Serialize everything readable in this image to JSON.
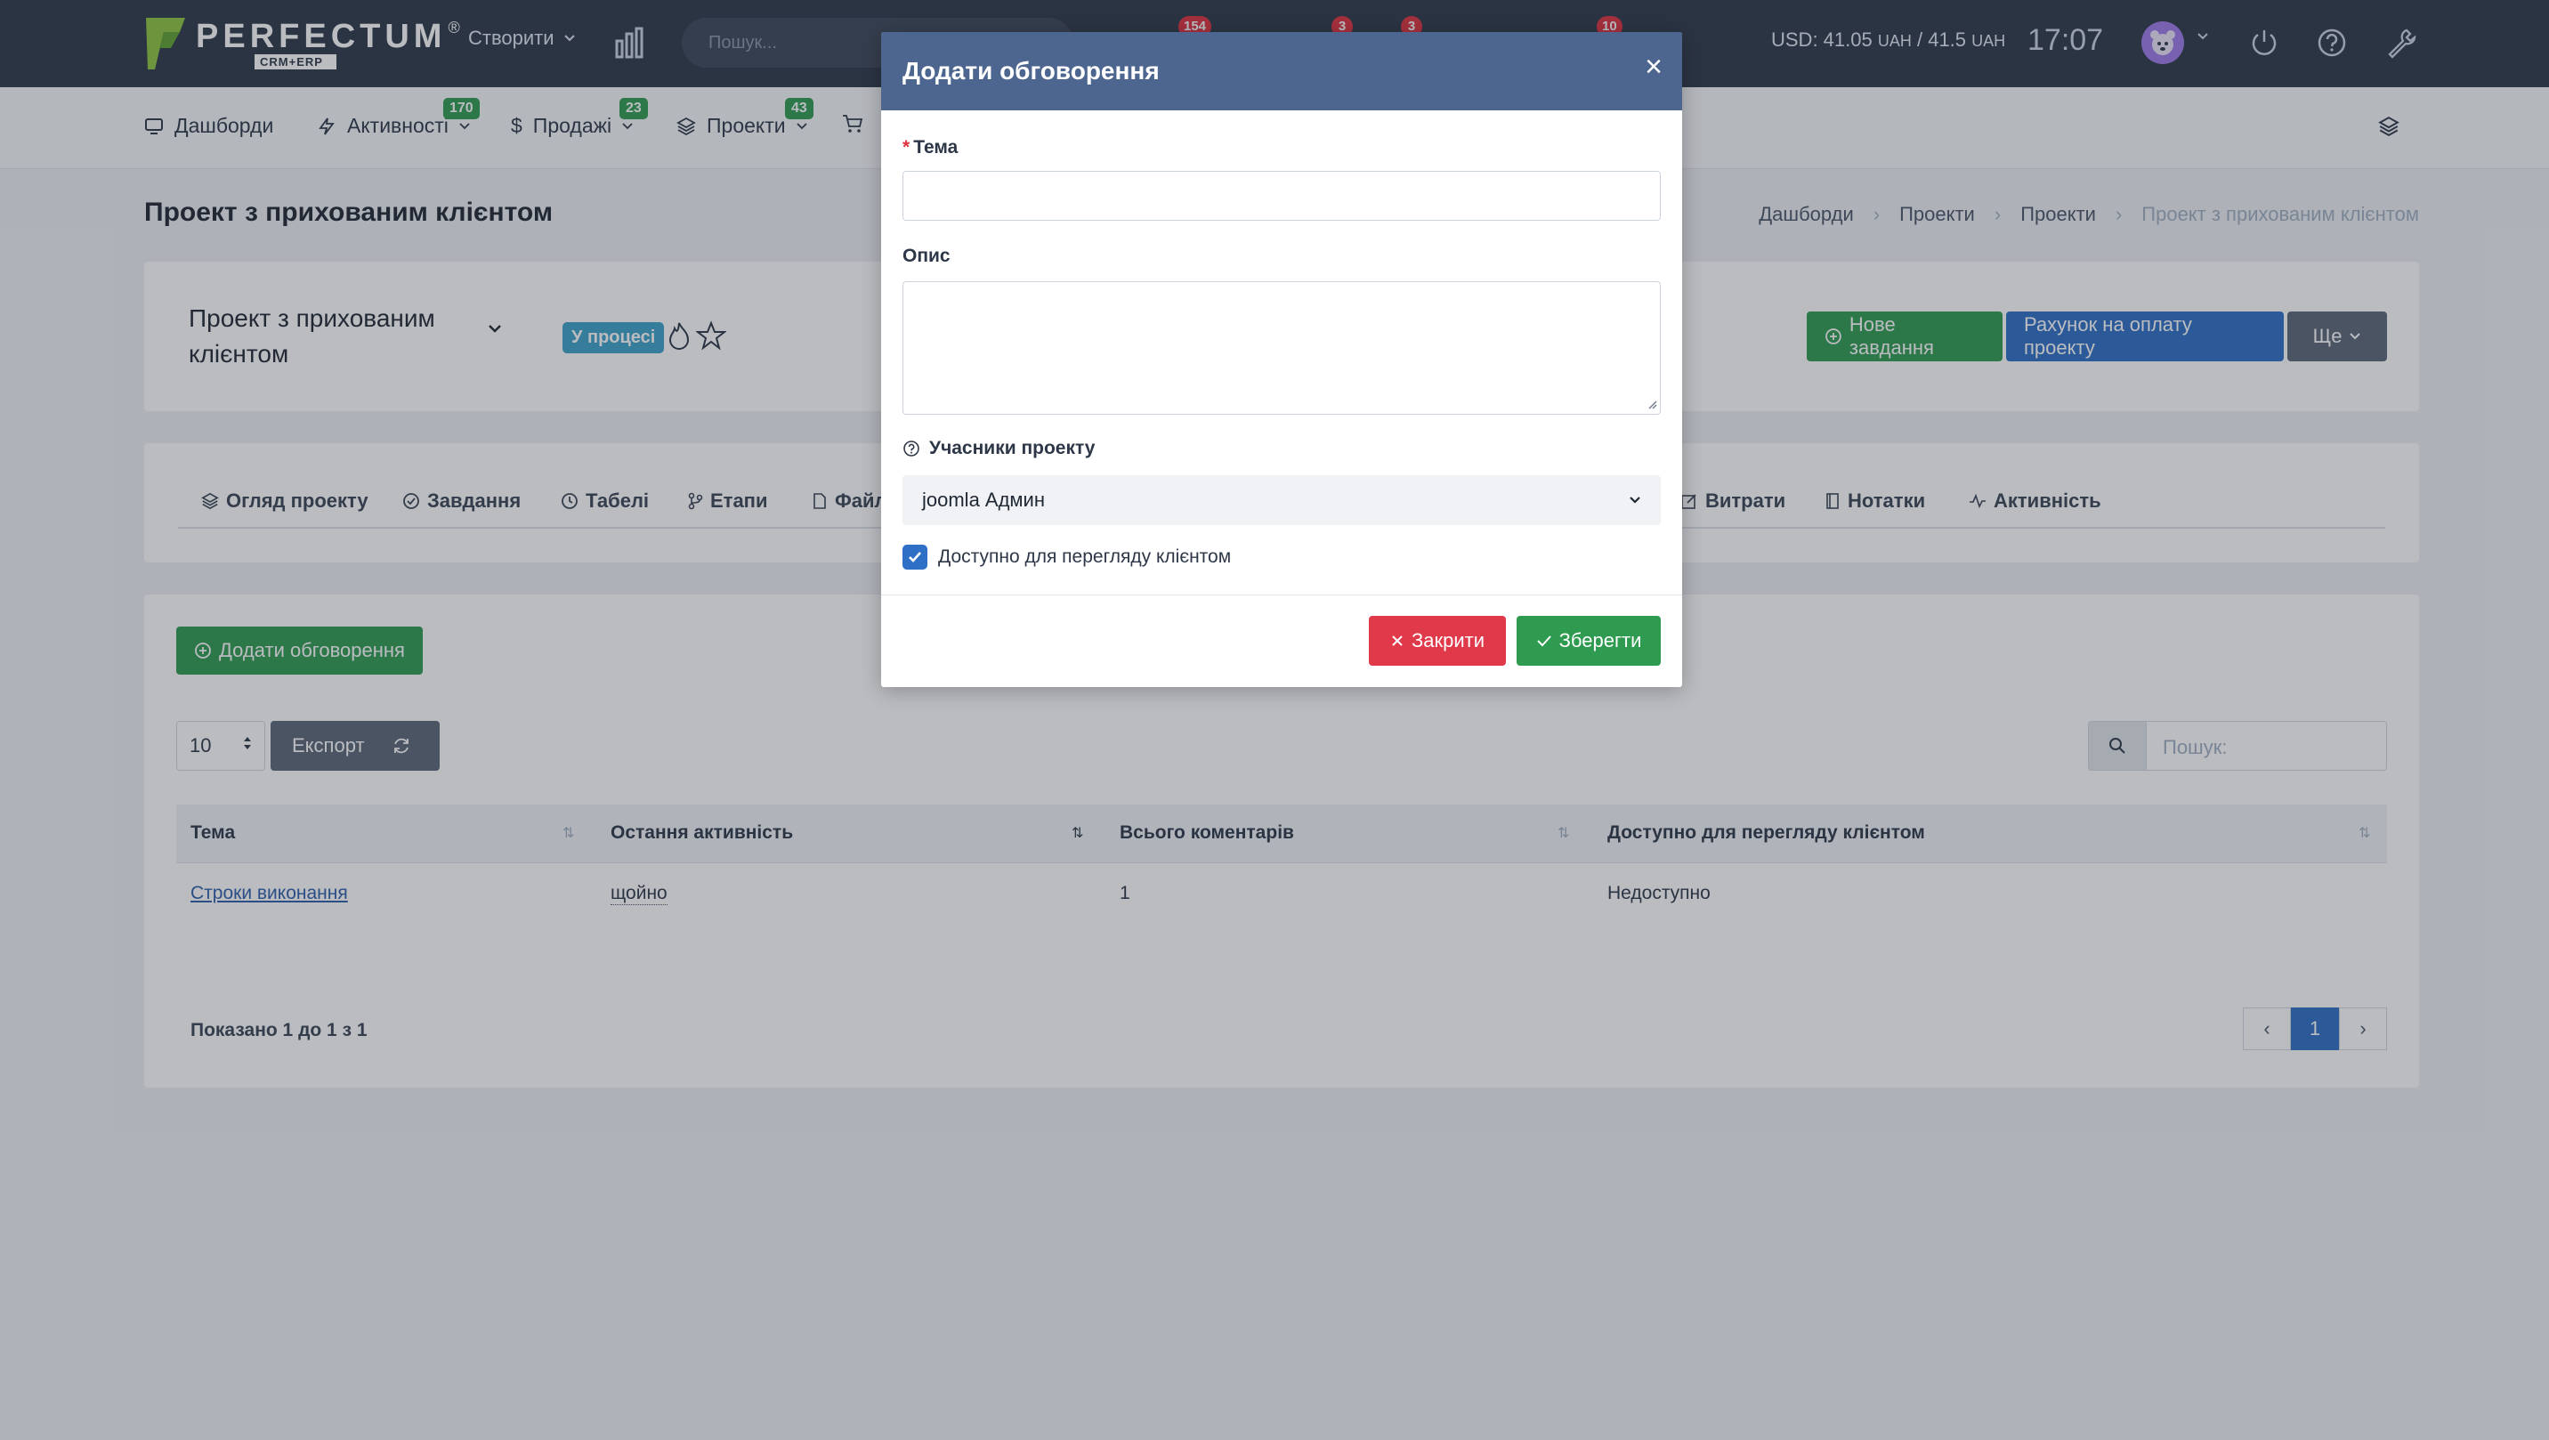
{
  "app": {
    "logo_name": "PERFECTUM",
    "logo_reg": "®",
    "logo_sub": "CRM+ERP",
    "create_label": "Створити",
    "search_placeholder": "Пошук...",
    "badges": [
      "154",
      "3",
      "3",
      "10"
    ],
    "currency_usd": "USD: 41.05",
    "currency_uah1": "UAH",
    "currency_mid": " / 41.5 ",
    "currency_uah2": "UAH",
    "clock": "17:07"
  },
  "subnav": {
    "items": [
      {
        "label": "Дашборди",
        "icon": "monitor-icon"
      },
      {
        "label": "Активності",
        "icon": "bolt-icon",
        "badge": "170"
      },
      {
        "label": "Продажі",
        "icon": "dollar-icon",
        "badge": "23"
      },
      {
        "label": "Проекти",
        "icon": "layers-icon",
        "badge": "43"
      }
    ]
  },
  "page": {
    "title": "Проект з прихованим клієнтом",
    "breadcrumb": [
      "Дашборди",
      "Проекти",
      "Проекти",
      "Проект з прихованим клієнтом"
    ]
  },
  "project": {
    "name": "Проект з прихованим клієнтом",
    "status": "У процесі",
    "new_task_label": "Нове завдання",
    "invoice_label": "Рахунок на оплату проекту",
    "more_label": "Ще"
  },
  "tabs": [
    {
      "label": "Огляд проекту",
      "icon": "layers-icon"
    },
    {
      "label": "Завдання",
      "icon": "check-circle-icon"
    },
    {
      "label": "Табелі",
      "icon": "clock-icon"
    },
    {
      "label": "Етапи",
      "icon": "branch-icon"
    },
    {
      "label": "Файл",
      "icon": "file-icon"
    },
    {
      "label": "Витрати",
      "icon": "edit-icon"
    },
    {
      "label": "Нотатки",
      "icon": "notebook-icon"
    },
    {
      "label": "Активність",
      "icon": "activity-icon"
    }
  ],
  "discussions": {
    "add_label": "Додати обговорення",
    "page_length": "10",
    "export_label": "Експорт",
    "search_placeholder": "Пошук:",
    "columns": [
      "Тема",
      "Остання активність",
      "Всього коментарів",
      "Доступно для перегляду клієнтом"
    ],
    "rows": [
      {
        "topic": "Строки виконання",
        "last_activity": "щойно",
        "comments": "1",
        "visible": "Недоступно"
      }
    ],
    "info": "Показано 1 до 1 з 1",
    "pages": [
      "1"
    ]
  },
  "modal": {
    "title": "Додати обговорення",
    "close_glyph": "×",
    "topic_label": "Тема",
    "topic_value": "",
    "description_label": "Опис",
    "description_value": "",
    "members_label": "Учасники проекту",
    "members_selected": "joomla Админ",
    "client_visible_label": "Доступно для перегляду клієнтом",
    "client_visible_checked": true,
    "cancel_label": "Закрити",
    "save_label": "Зберегти"
  },
  "colors": {
    "topbar": "#2d3748",
    "modal_header": "#4d6690",
    "primary": "#2f6fc6",
    "success": "#2f9b50",
    "danger": "#e0394a",
    "info": "#3ba2c9"
  }
}
